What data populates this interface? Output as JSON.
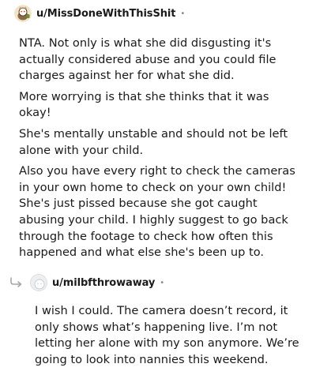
{
  "comments": [
    {
      "username": "u/MissDoneWithThisShit",
      "separator": "•",
      "avatar_icon": "snoo-avatar-icon",
      "paragraphs": [
        "NTA. Not only is what she did disgusting it's actually considered abuse and you could file charges against her for what she did.",
        "More worrying is that she thinks that it was okay!",
        "She's mentally unstable and should not be left alone with your child.",
        "Also you have every right to check the cameras in your own home to check on your own child! She's just pissed because she got caught abusing your child. I highly suggest to go back through the footage to check how often this happened and what else she's been up to."
      ]
    },
    {
      "username": "u/milbfthrowaway",
      "separator": "•",
      "avatar_icon": "default-avatar-icon",
      "reply_icon": "reply-arrow-icon",
      "paragraphs": [
        "I wish I could. The camera doesn’t record, it only shows what’s happening live. I’m not letting her alone with my son anymore. We’re going to look into nannies this weekend."
      ]
    }
  ]
}
